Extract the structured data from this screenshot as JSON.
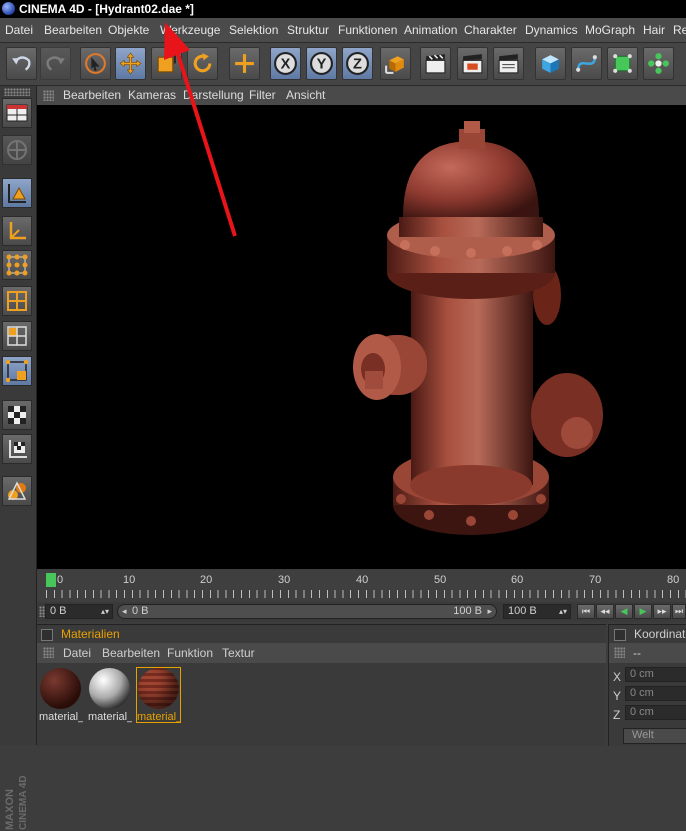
{
  "window": {
    "title": "CINEMA 4D - [Hydrant02.dae *]"
  },
  "menubar": {
    "items": [
      "Datei",
      "Bearbeiten",
      "Objekte",
      "Werkzeuge",
      "Selektion",
      "Struktur",
      "Funktionen",
      "Animation",
      "Charakter",
      "Dynamics",
      "MoGraph",
      "Hair",
      "Re"
    ]
  },
  "toolbar": {
    "icons": [
      "undo-icon",
      "redo-icon",
      "live-selection-icon",
      "move-icon",
      "scale-icon",
      "rotate-icon",
      "world-axis-icon",
      "x-axis-lock-icon",
      "y-axis-lock-icon",
      "z-axis-lock-icon",
      "coordinate-system-icon",
      "render-view-icon",
      "render-picture-viewer-icon",
      "render-settings-icon",
      "cube-primitive-icon",
      "spline-icon",
      "nurbs-icon",
      "array-icon"
    ]
  },
  "left_toolbar": {
    "icons": [
      "layout-icon",
      "scene-icon",
      "model-mode-icon",
      "object-axis-icon",
      "points-mode-icon",
      "edges-mode-icon",
      "polygons-mode-icon",
      "uvw-mode-icon",
      "texture-mode-icon",
      "workplane-icon",
      "snap-icon"
    ]
  },
  "viewport": {
    "menu": [
      "Bearbeiten",
      "Kameras",
      "Darstellung",
      "Filter",
      "Ansicht"
    ]
  },
  "timeline": {
    "ticks": [
      "0",
      "10",
      "20",
      "30",
      "40",
      "50",
      "60",
      "70",
      "80"
    ],
    "current_frame": "0"
  },
  "transport": {
    "start_field": "0 B",
    "slider_left": "0 B",
    "slider_right": "100 B",
    "end_field": "100 B"
  },
  "materials": {
    "panel_title": "Materialien",
    "menu": [
      "Datei",
      "Bearbeiten",
      "Funktion",
      "Textur"
    ],
    "items": [
      {
        "label": "material_",
        "selected": false
      },
      {
        "label": "material_",
        "selected": false
      },
      {
        "label": "material_",
        "selected": true
      }
    ]
  },
  "coordinates": {
    "panel_title": "Koordinaten",
    "dash": "--",
    "rows": [
      {
        "axis": "X",
        "value": "0 cm"
      },
      {
        "axis": "Y",
        "value": "0 cm"
      },
      {
        "axis": "Z",
        "value": "0 cm"
      }
    ],
    "mode": "Welt"
  },
  "brand": {
    "text": "MAXON CINEMA 4D"
  },
  "colors": {
    "accent_orange": "#e8a200",
    "selection_blue": "#6d87b5",
    "annotation_red": "#e8141a"
  }
}
